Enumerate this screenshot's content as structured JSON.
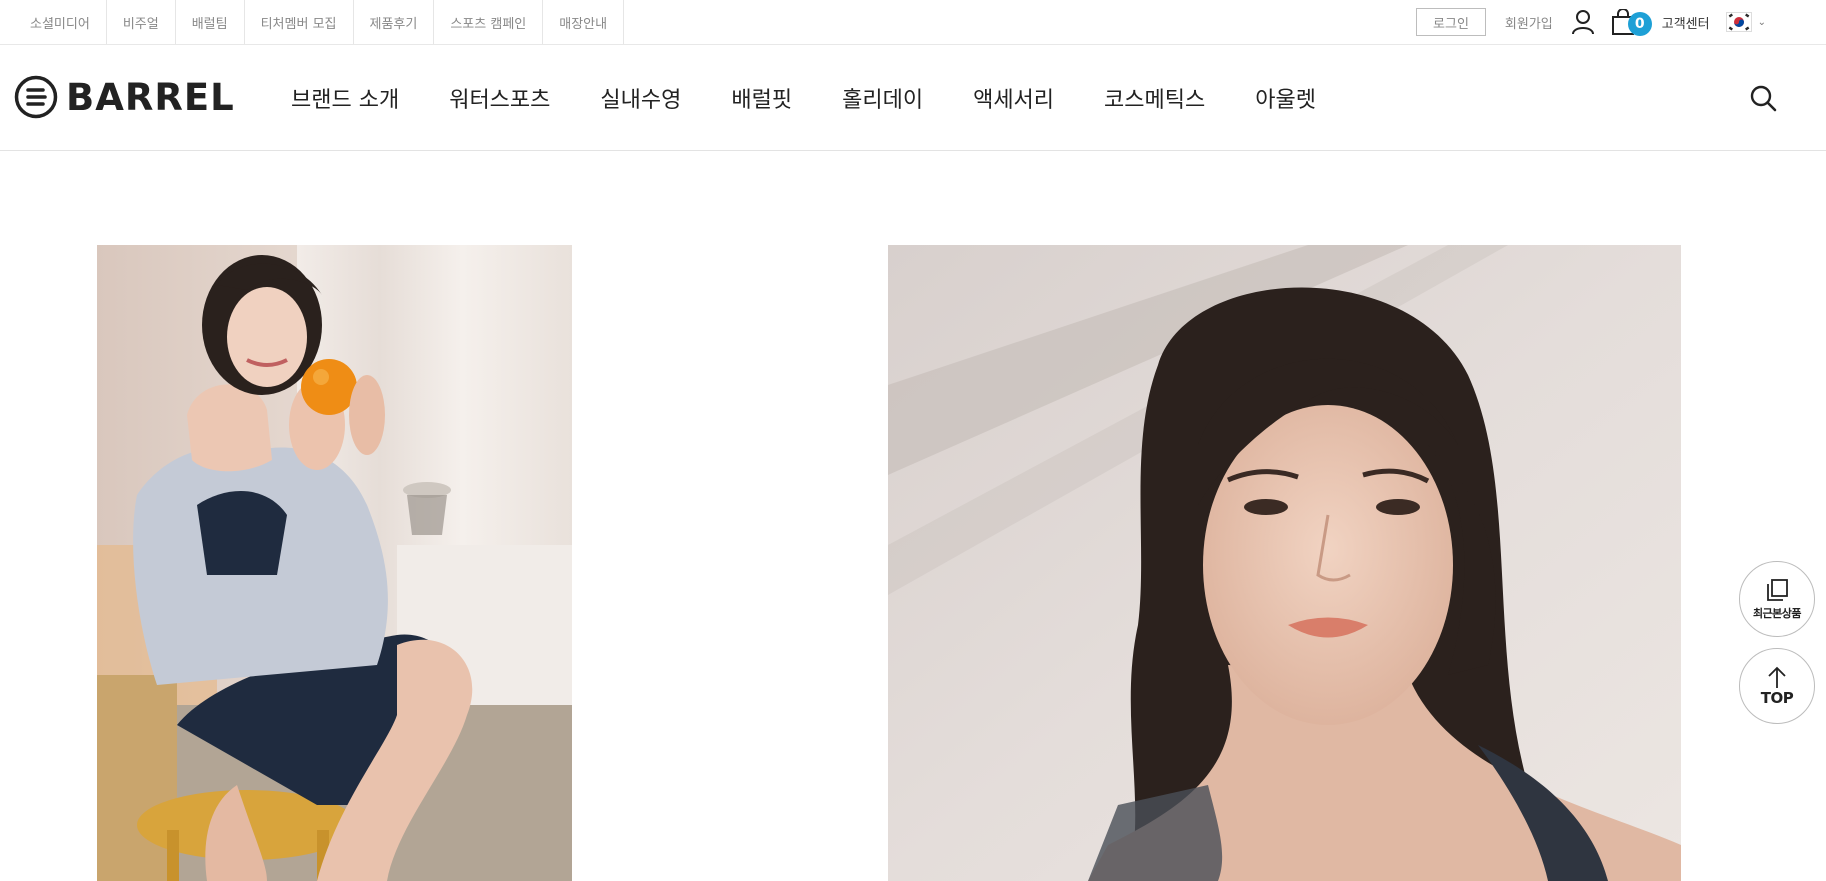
{
  "topbar": {
    "links": [
      "소셜미디어",
      "비주얼",
      "배럴팀",
      "티처멤버 모집",
      "제품후기",
      "스포츠 캠페인",
      "매장안내"
    ],
    "login_label": "로그인",
    "join_label": "회원가입",
    "cart_count": "0",
    "cs_label": "고객센터",
    "language_flag": "korea-flag-icon"
  },
  "header": {
    "logo_text": "BARREL",
    "nav": [
      "브랜드 소개",
      "워터스포츠",
      "실내수영",
      "배럴핏",
      "홀리데이",
      "액세서리",
      "코스메틱스",
      "아울렛"
    ]
  },
  "floating": {
    "recent_label": "최근본상품",
    "top_label": "TOP"
  },
  "colors": {
    "accent": "#1ea0d6",
    "text": "#222222",
    "muted": "#888888"
  }
}
